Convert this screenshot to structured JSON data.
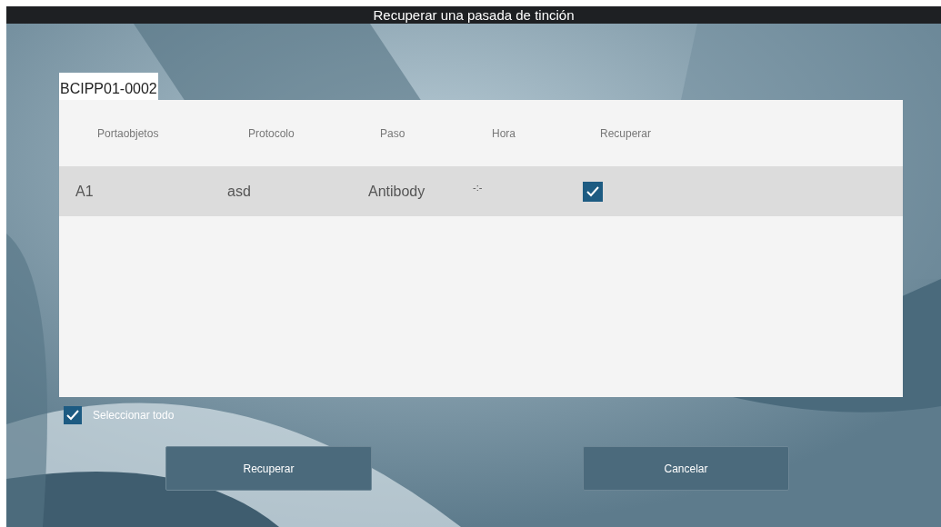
{
  "window": {
    "title": "Recuperar una pasada de tinción"
  },
  "tab": {
    "label": "BCIPP01-0002",
    "selected": true
  },
  "table": {
    "columns": [
      "Portaobjetos",
      "Protocolo",
      "Paso",
      "Hora",
      "Recuperar"
    ],
    "rows": [
      {
        "slide": "A1",
        "protocol": "asd",
        "step": "Antibody",
        "time": "-:-",
        "recover": true,
        "selected": true
      }
    ]
  },
  "select_all": {
    "label": "Seleccionar todo",
    "checked": true
  },
  "buttons": [
    "Recuperar",
    "Cancelar"
  ]
}
